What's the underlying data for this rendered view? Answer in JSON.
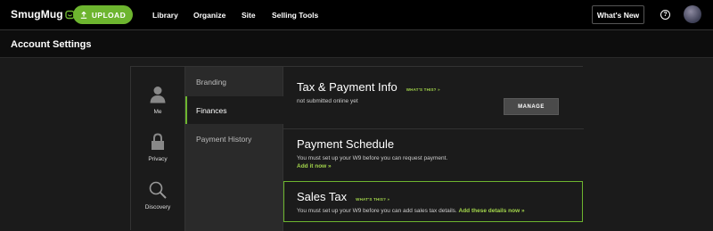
{
  "header": {
    "logo_text": "SmugMug",
    "upload_label": "UPLOAD",
    "nav": [
      "Library",
      "Organize",
      "Site",
      "Selling Tools"
    ],
    "whats_new_label": "What's New",
    "help_glyph": "?",
    "accent_color": "#6db52f"
  },
  "page": {
    "title": "Account Settings"
  },
  "categories": [
    {
      "label": "Me",
      "icon": "person-icon"
    },
    {
      "label": "Privacy",
      "icon": "lock-icon"
    },
    {
      "label": "Discovery",
      "icon": "magnifier-icon"
    }
  ],
  "subnav": [
    {
      "label": "Branding",
      "active": false
    },
    {
      "label": "Finances",
      "active": true
    },
    {
      "label": "Payment History",
      "active": false
    }
  ],
  "sections": {
    "tax": {
      "title": "Tax & Payment Info",
      "whats_this": "WHAT'S THIS? »",
      "text": "not submitted online yet",
      "button": "MANAGE"
    },
    "schedule": {
      "title": "Payment Schedule",
      "text": "You must set up your W9 before you can request payment.",
      "link": "Add it now »"
    },
    "sales_tax": {
      "title": "Sales Tax",
      "whats_this": "WHAT'S THIS? »",
      "text": "You must set up your W9 before you can add sales tax details.",
      "link": "Add these details now »"
    }
  }
}
